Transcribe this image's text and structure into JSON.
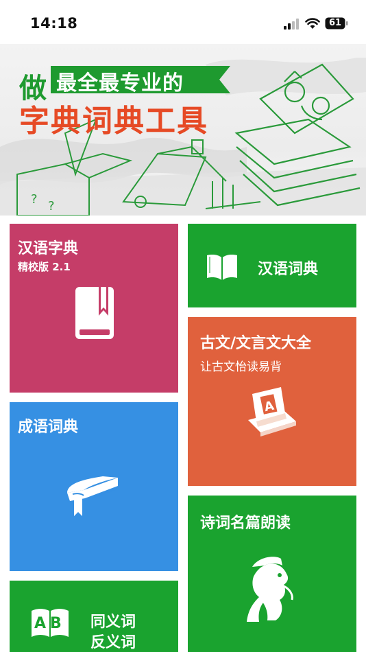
{
  "status_bar": {
    "time": "14:18",
    "battery": "61"
  },
  "banner": {
    "lead_char": "做",
    "ribbon_text": "最全最专业的",
    "headline": "字典词典工具"
  },
  "tiles": {
    "hanzi": {
      "title": "汉语字典",
      "subtitle": "精校版 2.1"
    },
    "ciyu": {
      "title": "汉语词典"
    },
    "guwen": {
      "title": "古文/文言文大全",
      "subtitle": "让古文怡读易背"
    },
    "chengyu": {
      "title": "成语词典"
    },
    "shici": {
      "title": "诗词名篇朗读"
    },
    "tongyi": {
      "line1": "同义词",
      "line2": "反义词",
      "icon_letters": "AB"
    }
  },
  "colors": {
    "hanzi": "#c53d68",
    "green": "#1aa32f",
    "guwen": "#e0613d",
    "chengyu": "#3690e3",
    "headline_red": "#e64a25"
  }
}
